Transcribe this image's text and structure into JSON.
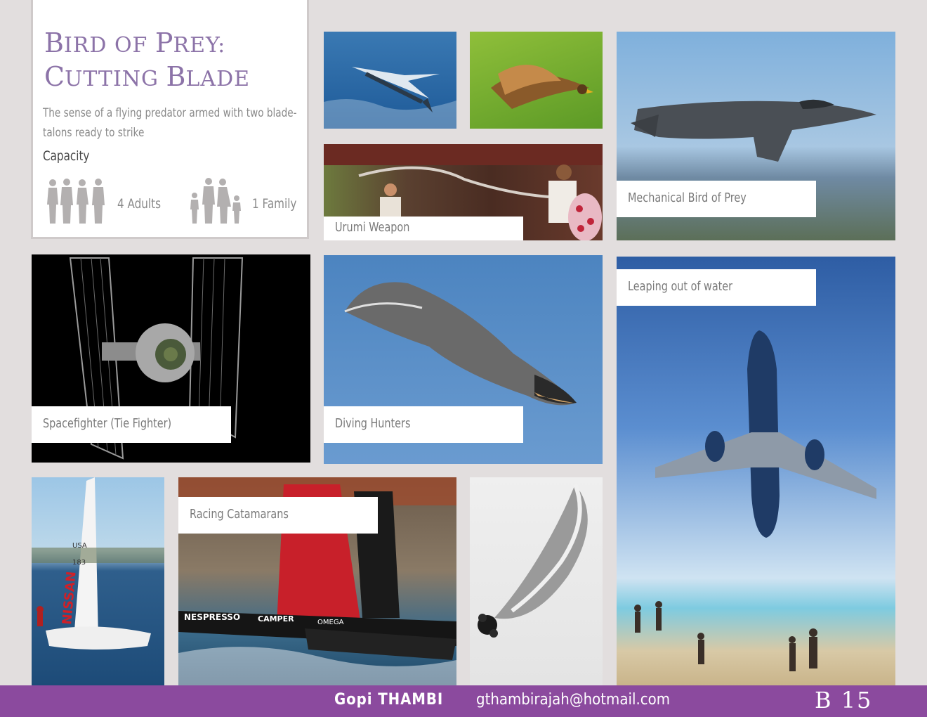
{
  "title": {
    "line1_first": "B",
    "line1_rest": "IRD OF ",
    "line1_p": "P",
    "line1_rest2": "REY:",
    "line2_first": "C",
    "line2_rest": "UTTING ",
    "line2_b": "B",
    "line2_rest2": "LADE"
  },
  "description": "The sense of a flying predator armed with two blade-talons ready to strike",
  "capacity": {
    "label": "Capacity",
    "adults": "4 Adults",
    "family": "1 Family"
  },
  "captions": {
    "mechanical": "Mechanical Bird of Prey",
    "urumi": "Urumi Weapon",
    "spacefighter": "Spacefighter (Tie Fighter)",
    "diving": "Diving Hunters",
    "leaping": "Leaping out of water",
    "racing": "Racing Catamarans"
  },
  "photo_text": {
    "sail_usa": "USA",
    "sail_num": "183",
    "sail_brand": "NISSAN",
    "cat_brand1": "NESPRESSO",
    "cat_brand2": "CAMPER",
    "cat_brand3": "OMEGA"
  },
  "footer": {
    "name": "Gopi THAMBI",
    "email": "gthambirajah@hotmail.com",
    "page": "B 15"
  },
  "colors": {
    "accent": "#8b4a9e",
    "title": "#8c73a8",
    "background": "#e2dede"
  }
}
